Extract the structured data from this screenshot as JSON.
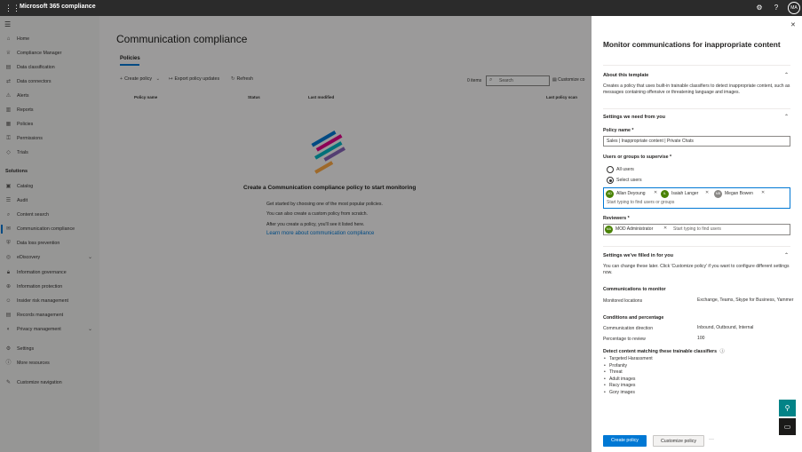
{
  "topbar": {
    "brand": "Microsoft 365 compliance",
    "avatar_initials": "MA"
  },
  "nav": {
    "items": [
      {
        "label": "Home",
        "icon": "home-icon"
      },
      {
        "label": "Compliance Manager",
        "icon": "trophy-icon"
      },
      {
        "label": "Data classification",
        "icon": "classification-icon"
      },
      {
        "label": "Data connectors",
        "icon": "connector-icon"
      },
      {
        "label": "Alerts",
        "icon": "alert-icon"
      },
      {
        "label": "Reports",
        "icon": "report-icon"
      },
      {
        "label": "Policies",
        "icon": "policy-icon"
      },
      {
        "label": "Permissions",
        "icon": "key-icon"
      },
      {
        "label": "Trials",
        "icon": "trial-icon"
      }
    ],
    "solutions_title": "Solutions",
    "solutions": [
      {
        "label": "Catalog",
        "icon": "catalog-icon"
      },
      {
        "label": "Audit",
        "icon": "audit-icon"
      },
      {
        "label": "Content search",
        "icon": "search-icon"
      },
      {
        "label": "Communication compliance",
        "icon": "chat-icon",
        "active": true
      },
      {
        "label": "Data loss prevention",
        "icon": "shield-icon"
      },
      {
        "label": "eDiscovery",
        "icon": "ediscovery-icon",
        "expandable": true
      },
      {
        "label": "Information governance",
        "icon": "lock-icon"
      },
      {
        "label": "Information protection",
        "icon": "protection-icon"
      },
      {
        "label": "Insider risk management",
        "icon": "insider-icon"
      },
      {
        "label": "Records management",
        "icon": "records-icon"
      },
      {
        "label": "Privacy management",
        "icon": "privacy-icon",
        "expandable": true
      }
    ],
    "bottom": [
      {
        "label": "Settings",
        "icon": "gear-icon"
      },
      {
        "label": "More resources",
        "icon": "info-icon"
      },
      {
        "label": "Customize navigation",
        "icon": "pencil-icon"
      }
    ]
  },
  "main": {
    "title": "Communication compliance",
    "tab": "Policies",
    "toolbar": {
      "create": "Create policy",
      "export": "Export policy updates",
      "refresh": "Refresh",
      "items_count": "0 items",
      "search_placeholder": "Search",
      "customize": "Customize co"
    },
    "columns": [
      "Policy name",
      "Status",
      "Last modified",
      "Last policy scan"
    ],
    "empty": {
      "title": "Create a Communication compliance policy to start monitoring",
      "line1": "Get started by choosing one of the most popular policies.",
      "line2": "You can also create a custom policy from scratch.",
      "line3": "After you create a policy, you'll see it listed here.",
      "link": "Learn more about communication compliance"
    }
  },
  "panel": {
    "title": "Monitor communications for inappropriate content",
    "about": {
      "heading": "About this template",
      "text": "Creates a policy that uses built-in trainable classifiers to detect inappropriate content, such as messages containing offensive or threatening language and images."
    },
    "settings_need": {
      "heading": "Settings we need from you",
      "policy_name_label": "Policy name *",
      "policy_name_value": "Sales | Inappropriate content | Private Chats",
      "users_label": "Users or groups to supervise *",
      "option_all": "All users",
      "option_select": "Select users",
      "selected_option": "select",
      "people": [
        {
          "initials": "AD",
          "name": "Allan Deyoung",
          "color": "#498205"
        },
        {
          "initials": "IL",
          "name": "Isaiah Langer",
          "color": "#498205"
        },
        {
          "initials": "MB",
          "name": "Megan Bowen",
          "color": "#8a8886"
        }
      ],
      "people_placeholder": "Start typing to find users or groups",
      "reviewers_label": "Reviewers *",
      "reviewer": {
        "initials": "MA",
        "name": "MOD Administrator",
        "color": "#498205"
      },
      "reviewers_placeholder": "Start typing to find users"
    },
    "settings_filled": {
      "heading": "Settings we've filled in for you",
      "text": "You can change these later. Click 'Customize policy' if you want to configure different settings now.",
      "comm_heading": "Communications to monitor",
      "monitored_label": "Monitored locations",
      "monitored_value": "Exchange, Teams, Skype for Business, Yammer",
      "conditions_heading": "Conditions and percentage",
      "direction_label": "Communication direction",
      "direction_value": "Inbound, Outbound, Internal",
      "percentage_label": "Percentage to review",
      "percentage_value": "100",
      "detect_heading": "Detect content matching these trainable classifiers",
      "classifiers": [
        "Targeted Harassment",
        "Profanity",
        "Threat",
        "Adult images",
        "Racy images",
        "Gory images"
      ]
    },
    "buttons": {
      "create": "Create policy",
      "customize": "Customize policy",
      "more": "···"
    }
  },
  "colors": {
    "accent": "#0078d4",
    "topbar": "#2b2b2b",
    "teal": "#038387"
  }
}
